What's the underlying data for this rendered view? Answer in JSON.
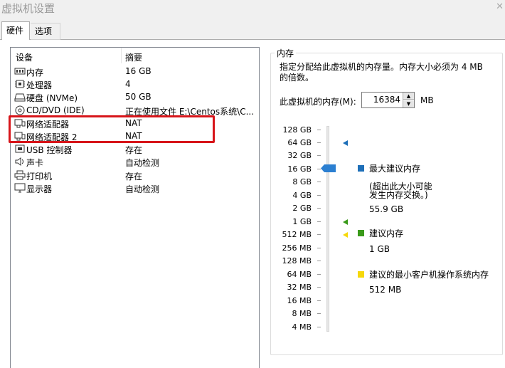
{
  "window": {
    "title": "虚拟机设置"
  },
  "tabs": [
    {
      "label": "硬件"
    },
    {
      "label": "选项"
    }
  ],
  "device_list": {
    "headers": {
      "device": "设备",
      "summary": "摘要"
    },
    "rows": [
      {
        "name": "内存",
        "summary": "16 GB",
        "icon": "memory-icon"
      },
      {
        "name": "处理器",
        "summary": "4",
        "icon": "cpu-icon"
      },
      {
        "name": "硬盘 (NVMe)",
        "summary": "50 GB",
        "icon": "disk-icon"
      },
      {
        "name": "CD/DVD (IDE)",
        "summary": "正在使用文件 E:\\Centos系统\\C...",
        "icon": "cd-icon"
      },
      {
        "name": "网络适配器",
        "summary": "NAT",
        "icon": "network-icon"
      },
      {
        "name": "网络适配器 2",
        "summary": "NAT",
        "icon": "network-icon"
      },
      {
        "name": "USB 控制器",
        "summary": "存在",
        "icon": "usb-icon"
      },
      {
        "name": "声卡",
        "summary": "自动检测",
        "icon": "speaker-icon"
      },
      {
        "name": "打印机",
        "summary": "存在",
        "icon": "printer-icon"
      },
      {
        "name": "显示器",
        "summary": "自动检测",
        "icon": "monitor-icon"
      }
    ]
  },
  "memory": {
    "group_label": "内存",
    "description": "指定分配给此虚拟机的内存量。内存大小必须为 4 MB 的倍数。",
    "field_label": "此虚拟机的内存(M):",
    "value": "16384",
    "unit": "MB",
    "scale": [
      "128 GB",
      "64 GB",
      "32 GB",
      "16 GB",
      "8 GB",
      "4 GB",
      "2 GB",
      "1 GB",
      "512 MB",
      "256 MB",
      "128 MB",
      "64 MB",
      "32 MB",
      "16 MB",
      "8 MB",
      "4 MB"
    ],
    "legend": {
      "max": {
        "title": "最大建议内存",
        "note1": "(超出此大小可能",
        "note2": "发生内存交换。)",
        "value": "55.9 GB"
      },
      "recommended": {
        "title": "建议内存",
        "value": "1 GB"
      },
      "min_guest": {
        "title": "建议的最小客户机操作系统内存",
        "value": "512 MB"
      }
    },
    "colors": {
      "max": "#1e6fb8",
      "recommended": "#3a9a1a",
      "min_guest": "#f6d80a",
      "thumb": "#2b7fd1"
    }
  },
  "highlight_color": "#d7151a"
}
